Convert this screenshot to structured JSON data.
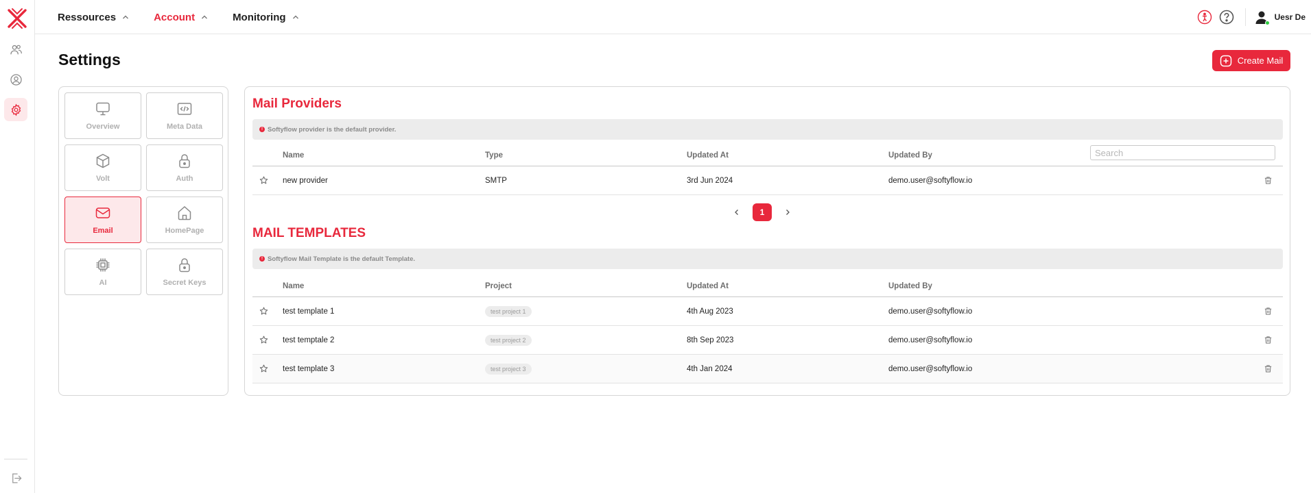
{
  "rail": {
    "items": [
      {
        "name": "users"
      },
      {
        "name": "profile"
      },
      {
        "name": "settings",
        "active": true
      }
    ]
  },
  "topnav": {
    "items": [
      {
        "label": "Ressources",
        "active": false
      },
      {
        "label": "Account",
        "active": true
      },
      {
        "label": "Monitoring",
        "active": false
      }
    ]
  },
  "user": {
    "name": "Uesr De"
  },
  "page": {
    "title": "Settings",
    "create_label": "Create Mail"
  },
  "settings_tiles": [
    {
      "label": "Overview",
      "icon": "monitor-icon",
      "active": false
    },
    {
      "label": "Meta Data",
      "icon": "code-icon",
      "active": false
    },
    {
      "label": "Volt",
      "icon": "cube-icon",
      "active": false
    },
    {
      "label": "Auth",
      "icon": "lock-icon",
      "active": false
    },
    {
      "label": "Email",
      "icon": "mail-icon",
      "active": true
    },
    {
      "label": "HomePage",
      "icon": "home-icon",
      "active": false
    },
    {
      "label": "AI",
      "icon": "chip-icon",
      "active": false
    },
    {
      "label": "Secret Keys",
      "icon": "lock-icon",
      "active": false
    }
  ],
  "providers": {
    "title": "Mail Providers",
    "notice": "Softyflow provider is the default provider.",
    "columns": [
      "Name",
      "Type",
      "Updated At",
      "Updated By"
    ],
    "search_placeholder": "Search",
    "rows": [
      {
        "name": "new provider",
        "type": "SMTP",
        "updated_at": "3rd Jun 2024",
        "updated_by": "demo.user@softyflow.io"
      }
    ],
    "page": "1"
  },
  "templates": {
    "title": "MAIL TEMPLATES",
    "notice": "Softyflow Mail Template is the default Template.",
    "columns": [
      "Name",
      "Project",
      "Updated At",
      "Updated By"
    ],
    "rows": [
      {
        "name": "test template 1",
        "project": "test project 1",
        "updated_at": "4th Aug 2023",
        "updated_by": "demo.user@softyflow.io"
      },
      {
        "name": "test temptale 2",
        "project": "test project 2",
        "updated_at": "8th Sep 2023",
        "updated_by": "demo.user@softyflow.io"
      },
      {
        "name": "test template 3",
        "project": "test project 3",
        "updated_at": "4th Jan 2024",
        "updated_by": "demo.user@softyflow.io"
      }
    ]
  },
  "colors": {
    "accent": "#e8283c",
    "accent_light": "#fde8ea",
    "notice_bg": "#ececec"
  }
}
